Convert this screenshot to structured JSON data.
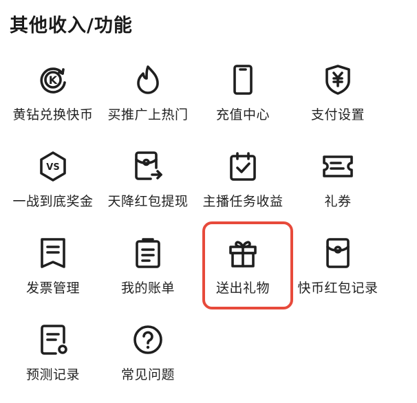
{
  "section": {
    "title": "其他收入/功能"
  },
  "items": [
    {
      "label": "黄钻兑换快币",
      "icon": "k-coin-exchange-icon"
    },
    {
      "label": "买推广上热门",
      "icon": "flame-icon"
    },
    {
      "label": "充值中心",
      "icon": "phone-icon"
    },
    {
      "label": "支付设置",
      "icon": "yen-shield-icon"
    },
    {
      "label": "一战到底奖金",
      "icon": "vs-shield-icon"
    },
    {
      "label": "天降红包提现",
      "icon": "redpacket-withdraw-icon"
    },
    {
      "label": "主播任务收益",
      "icon": "calendar-check-icon"
    },
    {
      "label": "礼券",
      "icon": "ticket-icon"
    },
    {
      "label": "发票管理",
      "icon": "invoice-icon"
    },
    {
      "label": "我的账单",
      "icon": "bill-icon"
    },
    {
      "label": "送出礼物",
      "icon": "gift-icon"
    },
    {
      "label": "快币红包记录",
      "icon": "redpacket-icon"
    },
    {
      "label": "预测记录",
      "icon": "prediction-record-icon"
    },
    {
      "label": "常见问题",
      "icon": "question-icon"
    }
  ],
  "highlight_color": "#e74a3b"
}
